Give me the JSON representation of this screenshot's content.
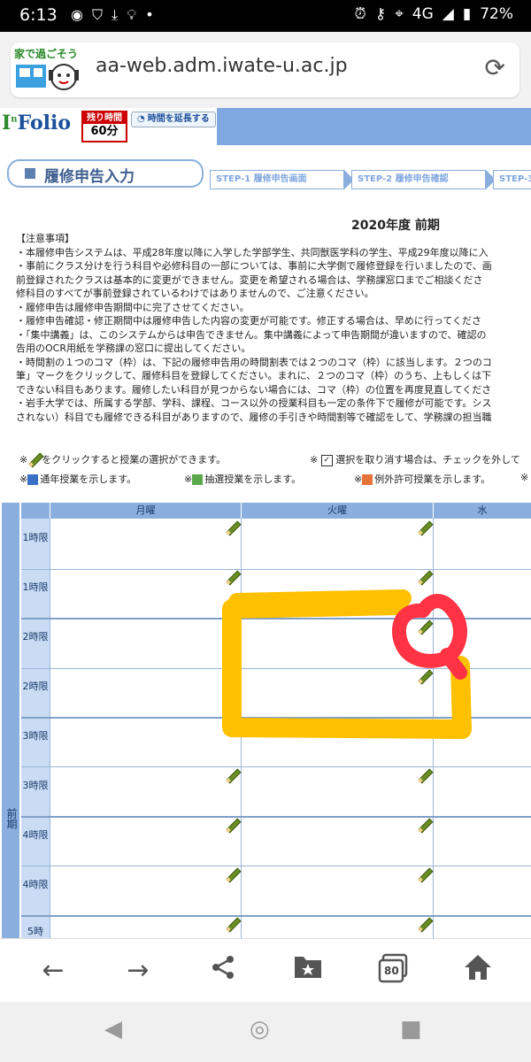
{
  "statusbar": {
    "time": "6:13",
    "network": "4G",
    "battery": "72%"
  },
  "browser": {
    "site_logo_text": "家で過ごそう",
    "url": "aa-web.adm.iwate-u.ac.jp"
  },
  "site": {
    "logo": "Folio",
    "timer_label": "残り時間",
    "timer_value": "60分",
    "extend_label": "時間を延長する"
  },
  "page": {
    "title": "履修申告入力",
    "steps": [
      "STEP-1 履修申告画面",
      "STEP-2 履修申告確認",
      "STEP-3"
    ],
    "term": "2020年度 前期"
  },
  "notices": [
    "【注意事項】",
    "・本履修申告システムは、平成28年度以降に入学した学部学生、共同獣医学科の学生、平成29年度以降に入",
    "・事前にクラス分けを行う科目や必修科目の一部については、事前に大学側で履修登録を行いましたので、画",
    "前登録されたクラスは基本的に変更ができません。変更を希望される場合は、学務課窓口までご相談くださ",
    "修科目のすべてが事前登録されているわけではありませんので、ご注意ください。",
    "・履修申告は履修申告期間中に完了させてください。",
    "・履修申告確認・修正期間中は履修申告した内容の変更が可能です。修正する場合は、早めに行ってくださ",
    "・「集中講義」は、このシステムからは申告できません。集中講義によって申告期間が違いますので、確認の",
    "告用のOCR用紙を学務課の窓口に提出してください。",
    "・時間割の１つのコマ（枠）は、下記の履修申告用の時間割表では２つのコマ（枠）に該当します。２つのコ",
    "筆」マークをクリックして、履修科目を登録してください。まれに、２つのコマ（枠）のうち、上もしくは下",
    "できない科目もあります。履修したい科目が見つからない場合には、コマ（枠）の位置を再度見直してくださ",
    "・岩手大学では、所属する学部、学科、課程、コース以外の授業科目も一定の条件下で履修が可能です。シス",
    "されない）科目でも履修できる科目がありますので、履修の手引きや時間割等で確認をして、学務課の担当職"
  ],
  "legend": {
    "pencil": "をクリックすると授業の選択ができます。",
    "uncheck": "選択を取り消す場合は、チェックを外して",
    "tsunen": "通年授業を示します。",
    "chusen": "抽選授業を示します。",
    "reigai": "例外許可授業を示します。",
    "mark": "※"
  },
  "timetable": {
    "semester": "前期",
    "days": [
      "月曜",
      "火曜",
      "水"
    ],
    "periods": [
      "1時限",
      "1時限",
      "2時限",
      "2時限",
      "3時限",
      "3時限",
      "4時限",
      "4時限",
      "5時"
    ]
  },
  "tab_count": "80",
  "colors": {
    "header_blue": "#7fa7e0",
    "annotation_yellow": "#ffc000",
    "annotation_red": "#ff3344"
  }
}
